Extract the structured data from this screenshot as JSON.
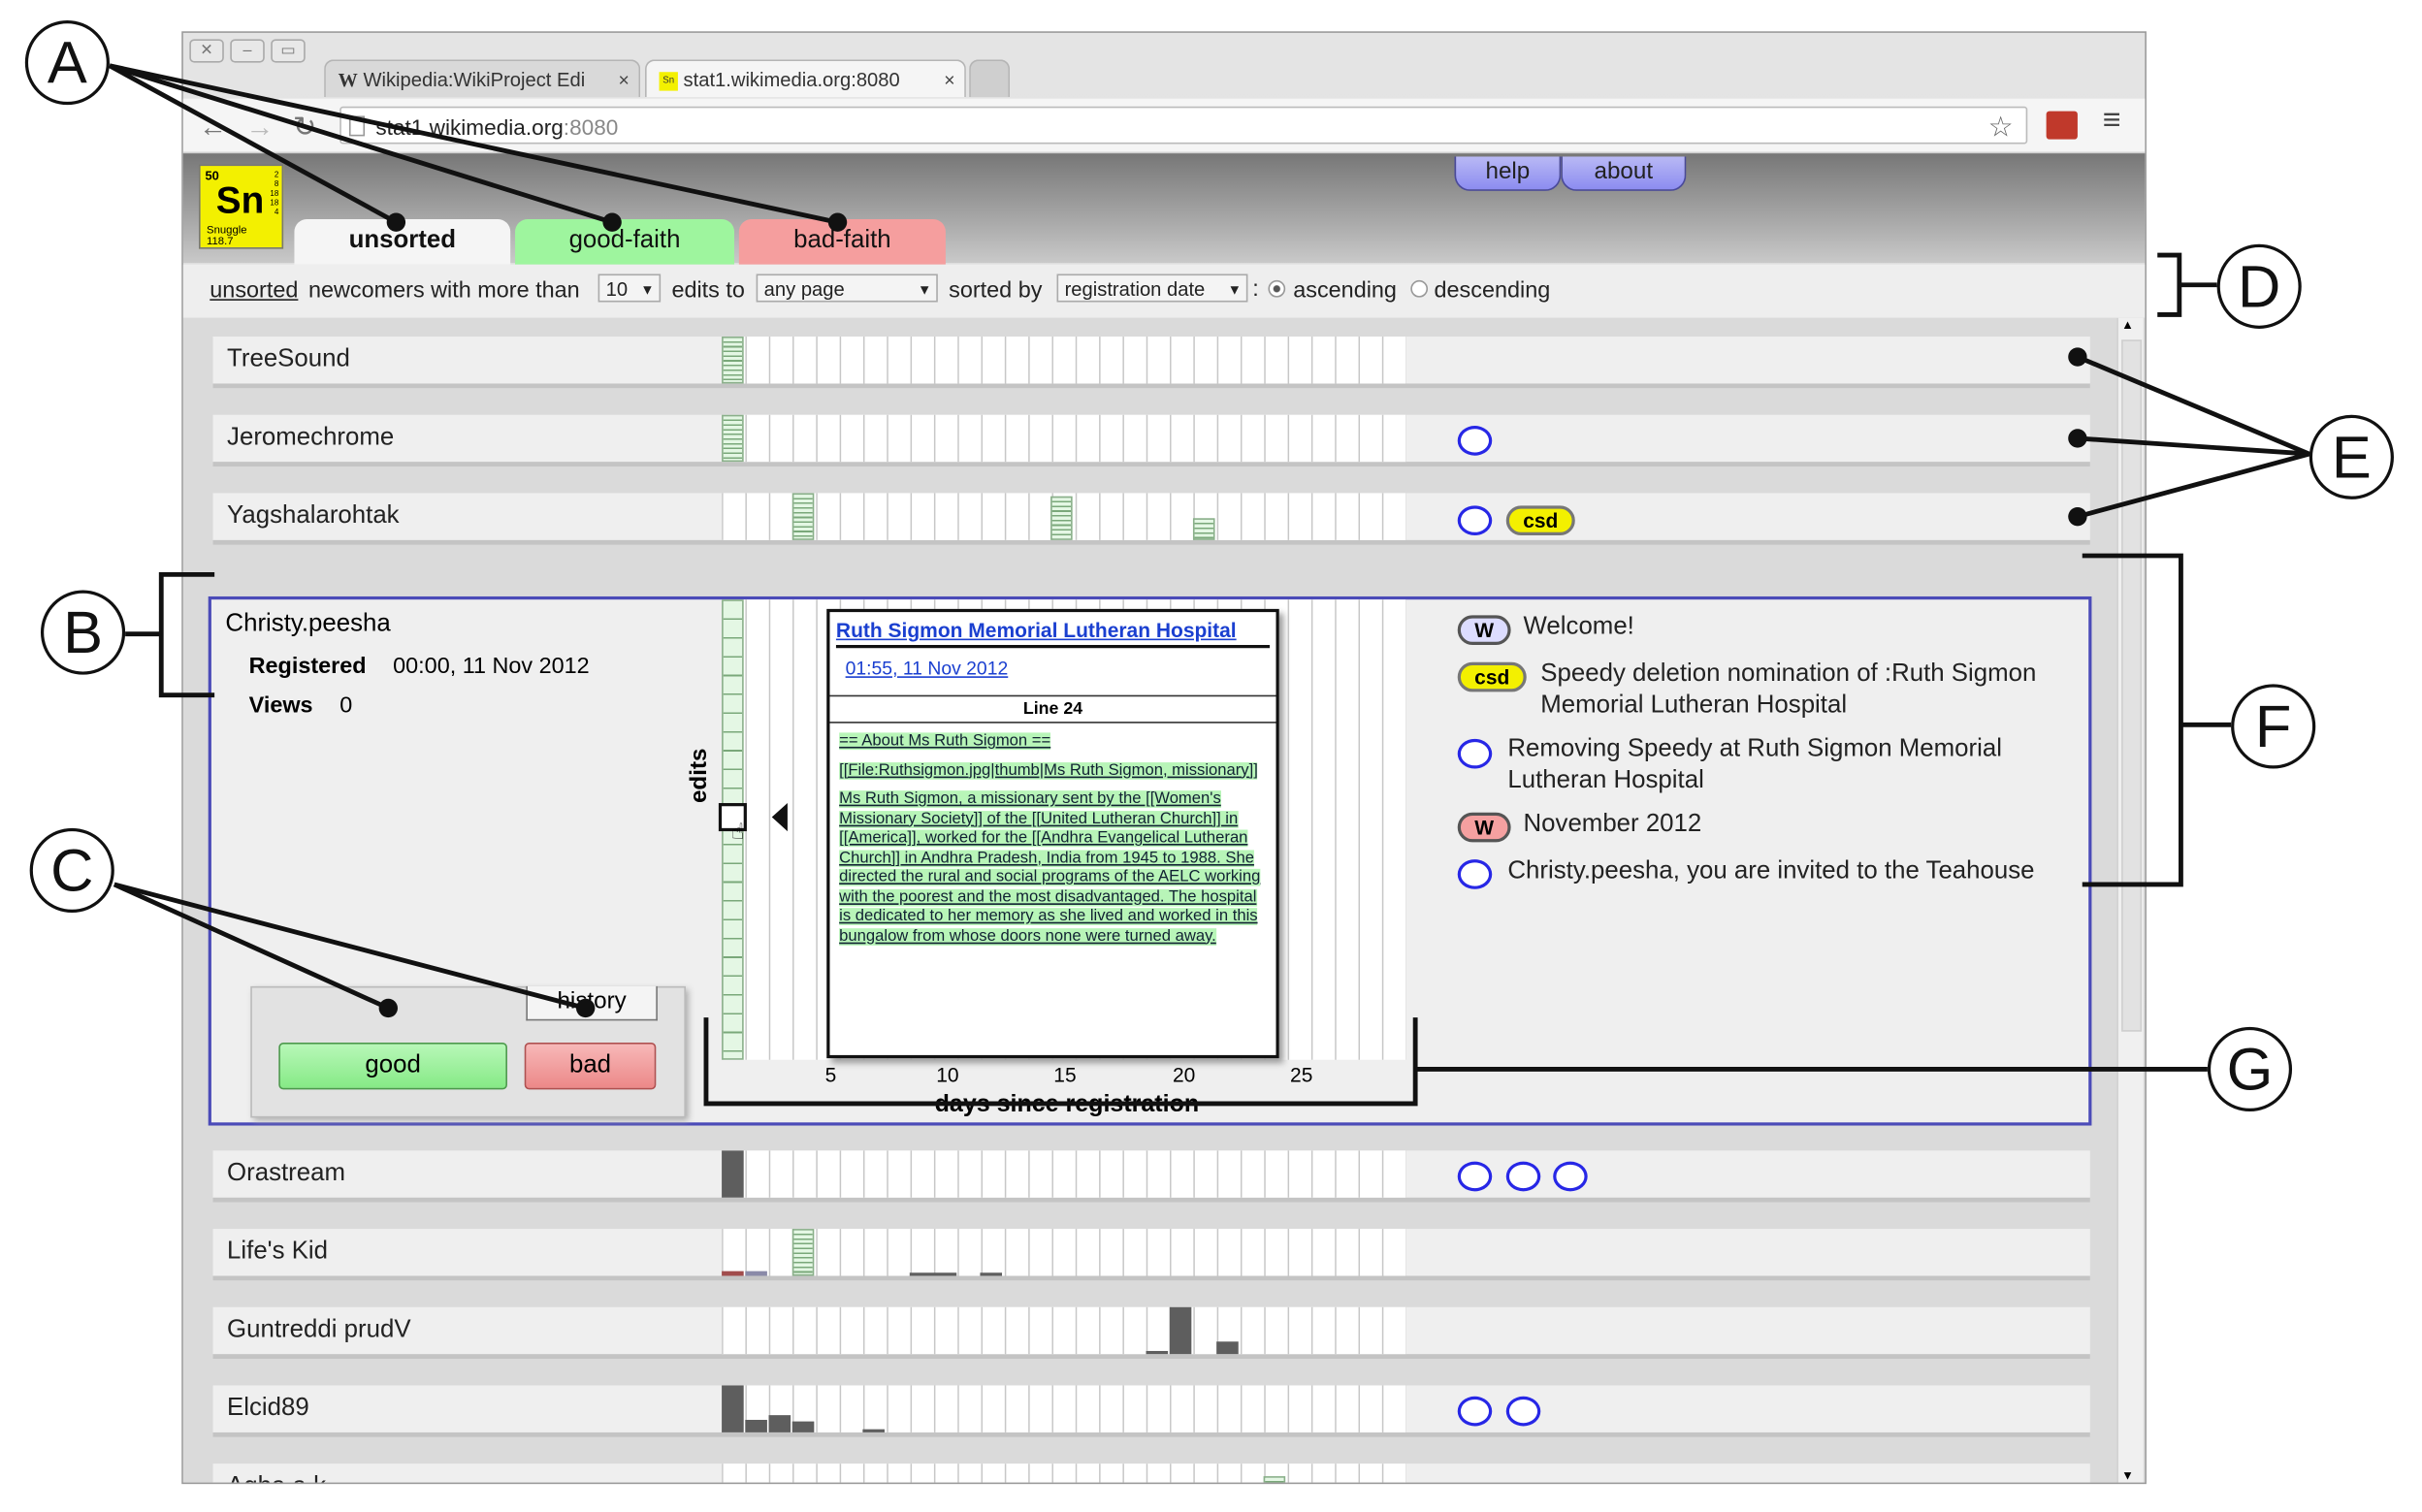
{
  "browser": {
    "tabs": [
      {
        "label": "Wikipedia:WikiProject Edi",
        "favicon": "W"
      },
      {
        "label": "stat1.wikimedia.org:8080",
        "favicon": "Sn"
      }
    ],
    "close_glyph": "×",
    "url_host": "stat1.wikimedia.org",
    "url_port": ":8080",
    "icons": [
      "back-icon",
      "forward-icon",
      "reload-icon",
      "page-icon",
      "star-icon",
      "extension-icon",
      "menu-icon"
    ]
  },
  "app": {
    "logo": {
      "number": "50",
      "symbol": "Sn",
      "name": "Snuggle",
      "mass": "118.7",
      "shells": "2\n8\n18\n18\n4"
    },
    "help_label": "help",
    "about_label": "about",
    "tabs": [
      {
        "label": "unsorted",
        "color": "#f5f5f5"
      },
      {
        "label": "good-faith",
        "color": "#9ef59e"
      },
      {
        "label": "bad-faith",
        "color": "#f59e9e"
      }
    ]
  },
  "filter": {
    "unsorted_link": "unsorted",
    "text1": "newcomers with more than",
    "min_edits": "10",
    "text2": "edits to",
    "namespace": "any page",
    "text3": "sorted by",
    "sort_field": "registration date",
    "colon": ":",
    "ascending": "ascending",
    "descending": "descending",
    "selected_order": "ascending"
  },
  "users": [
    {
      "name": "TreeSound"
    },
    {
      "name": "Jeromechrome"
    },
    {
      "name": "Yagshalarohtak"
    },
    {
      "name": "Christy.peesha"
    },
    {
      "name": "Orastream"
    },
    {
      "name": "Life's Kid"
    },
    {
      "name": "Guntreddi prudV"
    },
    {
      "name": "Elcid89"
    },
    {
      "name": "Agha a.k"
    }
  ],
  "expanded": {
    "registered_label": "Registered",
    "registered_value": "00:00, 11 Nov 2012",
    "views_label": "Views",
    "views_value": "0",
    "history_label": "history",
    "good_label": "good",
    "bad_label": "bad",
    "edits_label": "edits",
    "xlabel": "days since registration",
    "ticks": [
      "5",
      "10",
      "15",
      "20",
      "25"
    ],
    "popup": {
      "title": "Ruth Sigmon Memorial Lutheran Hospital",
      "time": "01:55, 11 Nov 2012",
      "line": "Line 24",
      "diff": [
        "== About Ms Ruth Sigmon ==",
        "[[File:Ruthsigmon.jpg|thumb|Ms Ruth Sigmon, missionary]]",
        "Ms Ruth Sigmon, a missionary sent by the [[Women's Missionary Society]] of the [[United Lutheran Church]] in [[America]], worked for the [[Andhra Evangelical Lutheran Church]] in Andhra Pradesh, India from 1945 to 1988. She directed the rural and social programs of the AELC working with the poorest and the most disadvantaged. The hospital is dedicated to her memory as she lived and worked in this bungalow from whose doors none were turned away."
      ]
    },
    "talk": [
      {
        "badge": "W",
        "badge_color": "#dcdcff",
        "text": "Welcome!"
      },
      {
        "badge": "csd",
        "badge_color": "#f3f000",
        "text": "Speedy deletion nomination of :Ruth Sigmon Memorial Lutheran Hospital"
      },
      {
        "badge": "",
        "badge_color": "#ffffff",
        "text": "Removing Speedy at Ruth Sigmon Memorial Lutheran Hospital"
      },
      {
        "badge": "W",
        "badge_color": "#f5a0a0",
        "text": "November 2012"
      },
      {
        "badge": "",
        "badge_color": "#ffffff",
        "text": "Christy.peesha, you are invited to the Teahouse"
      }
    ]
  },
  "inline_badges": {
    "csd": "csd"
  },
  "callouts": [
    "A",
    "B",
    "C",
    "D",
    "E",
    "F",
    "G"
  ]
}
